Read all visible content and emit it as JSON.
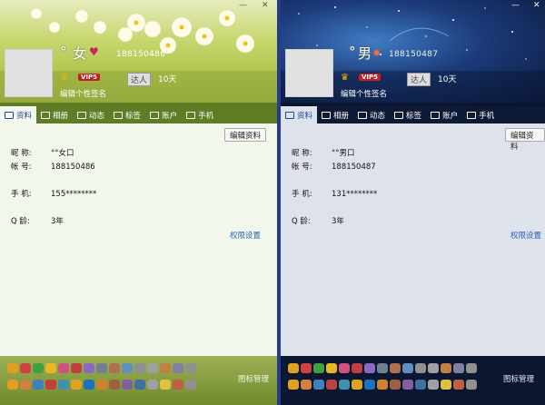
{
  "window_controls": {
    "minimize": "—",
    "close": "✕"
  },
  "profiles": [
    {
      "nickname_symbol": "°",
      "gender_label": "女",
      "uid_display": "188150486",
      "vip_label": "VIP5",
      "level_badge": "达人",
      "level_days": "10天",
      "signature_placeholder": "编辑个性签名",
      "tabs": [
        "资料",
        "相册",
        "动态",
        "标签",
        "账户",
        "手机"
      ],
      "edit_button": "编辑资料",
      "info": [
        {
          "key": "昵    称:",
          "value": "°°女口"
        },
        {
          "key": "帐    号:",
          "value": "188150486"
        },
        {
          "key": "手    机:",
          "value": "155********"
        },
        {
          "key": "Q      龄:",
          "value": "3年"
        }
      ],
      "permission_link": "权限设置",
      "icon_manager": "图标管理"
    },
    {
      "nickname_symbol": "°",
      "gender_label": "男",
      "uid_display": "188150487",
      "vip_label": "VIP5",
      "level_badge": "达人",
      "level_days": "10天",
      "signature_placeholder": "编辑个性签名",
      "tabs": [
        "资料",
        "相册",
        "动态",
        "标签",
        "账户",
        "手机"
      ],
      "edit_button": "编辑资料",
      "info": [
        {
          "key": "昵    称:",
          "value": "°°男口"
        },
        {
          "key": "帐    号:",
          "value": "188150487"
        },
        {
          "key": "手    机:",
          "value": "131********"
        },
        {
          "key": "Q      龄:",
          "value": "3年"
        }
      ],
      "permission_link": "权限设置",
      "icon_manager": "图标管理"
    }
  ],
  "colors": {
    "female_accent": "#8caf3a",
    "male_accent": "#1c3b7a",
    "link": "#2a63b8",
    "vip": "#c42020"
  },
  "icon_names": [
    "user-icon",
    "photo-icon",
    "feed-icon",
    "tag-icon",
    "account-icon",
    "phone-icon"
  ]
}
